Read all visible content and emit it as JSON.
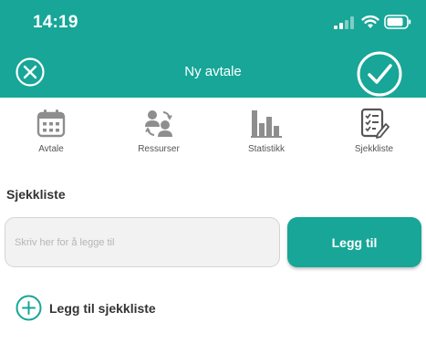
{
  "status_bar": {
    "time": "14:19"
  },
  "header": {
    "title": "Ny avtale",
    "close_icon": "close-circle-icon",
    "confirm_icon": "checkmark-circle-icon"
  },
  "tabs": [
    {
      "label": "Avtale",
      "icon": "calendar-icon"
    },
    {
      "label": "Ressurser",
      "icon": "people-icon"
    },
    {
      "label": "Statistikk",
      "icon": "bar-chart-icon"
    },
    {
      "label": "Sjekkliste",
      "icon": "checklist-icon"
    }
  ],
  "checklist": {
    "section_title": "Sjekkliste",
    "input_placeholder": "Skriv her for å legge til",
    "input_value": "",
    "add_button_label": "Legg til",
    "add_checklist_label": "Legg til sjekkliste"
  },
  "colors": {
    "accent": "#17A697",
    "icon_gray": "#8e8e8e",
    "text": "#333333"
  }
}
